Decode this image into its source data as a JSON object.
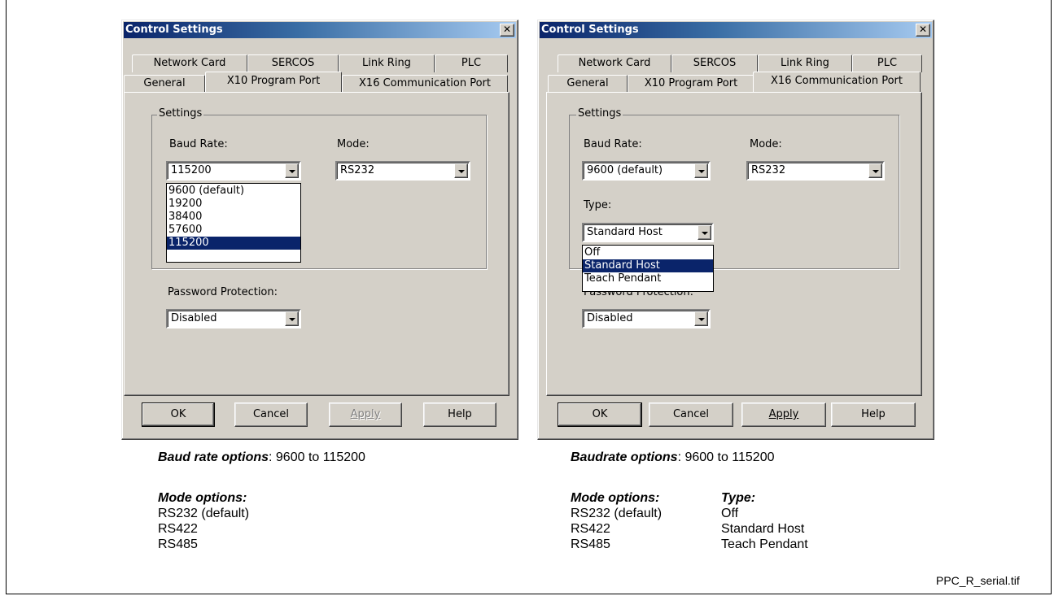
{
  "left_dialog": {
    "title": "Control Settings",
    "close_glyph": "✕",
    "tabs_back": [
      "Network Card",
      "SERCOS",
      "Link Ring",
      "PLC"
    ],
    "tabs_front": [
      "General",
      "X10 Program Port",
      "X16 Communication Port"
    ],
    "active_tab": "X10 Program Port",
    "settings_label": "Settings",
    "baud_label": "Baud Rate:",
    "baud_value": "115200",
    "baud_options": [
      "9600 (default)",
      "19200",
      "38400",
      "57600",
      "115200"
    ],
    "baud_selected": "115200",
    "mode_label": "Mode:",
    "mode_value": "RS232",
    "password_label": "Password Protection:",
    "password_value": "Disabled",
    "buttons": {
      "ok": "OK",
      "cancel": "Cancel",
      "apply": "Apply",
      "help": "Help"
    },
    "apply_enabled": false
  },
  "right_dialog": {
    "title": "Control Settings",
    "close_glyph": "✕",
    "tabs_back": [
      "Network Card",
      "SERCOS",
      "Link Ring",
      "PLC"
    ],
    "tabs_front": [
      "General",
      "X10 Program Port",
      "X16 Communication Port"
    ],
    "active_tab": "X16 Communication Port",
    "settings_label": "Settings",
    "baud_label": "Baud Rate:",
    "baud_value": "9600 (default)",
    "mode_label": "Mode:",
    "mode_value": "RS232",
    "type_label": "Type:",
    "type_value": "Standard Host",
    "type_options": [
      "Off",
      "Standard Host",
      "Teach Pendant"
    ],
    "type_selected": "Standard Host",
    "password_label": "Password Protection:",
    "password_value": "Disabled",
    "buttons": {
      "ok": "OK",
      "cancel": "Cancel",
      "apply": "Apply",
      "help": "Help"
    },
    "apply_enabled": true
  },
  "captions": {
    "left": {
      "baud_title": "Baud rate options",
      "baud_text": ": 9600 to 115200",
      "mode_title": "Mode options:",
      "mode_items": [
        "RS232 (default)",
        "RS422",
        "RS485"
      ]
    },
    "right": {
      "baud_title": "Baudrate options",
      "baud_text": ": 9600 to 115200",
      "mode_title": "Mode options:",
      "mode_items": [
        "RS232 (default)",
        "RS422",
        "RS485"
      ],
      "type_title": "Type:",
      "type_items": [
        "Off",
        "Standard Host",
        "Teach Pendant"
      ]
    }
  },
  "filename": "PPC_R_serial.tif"
}
